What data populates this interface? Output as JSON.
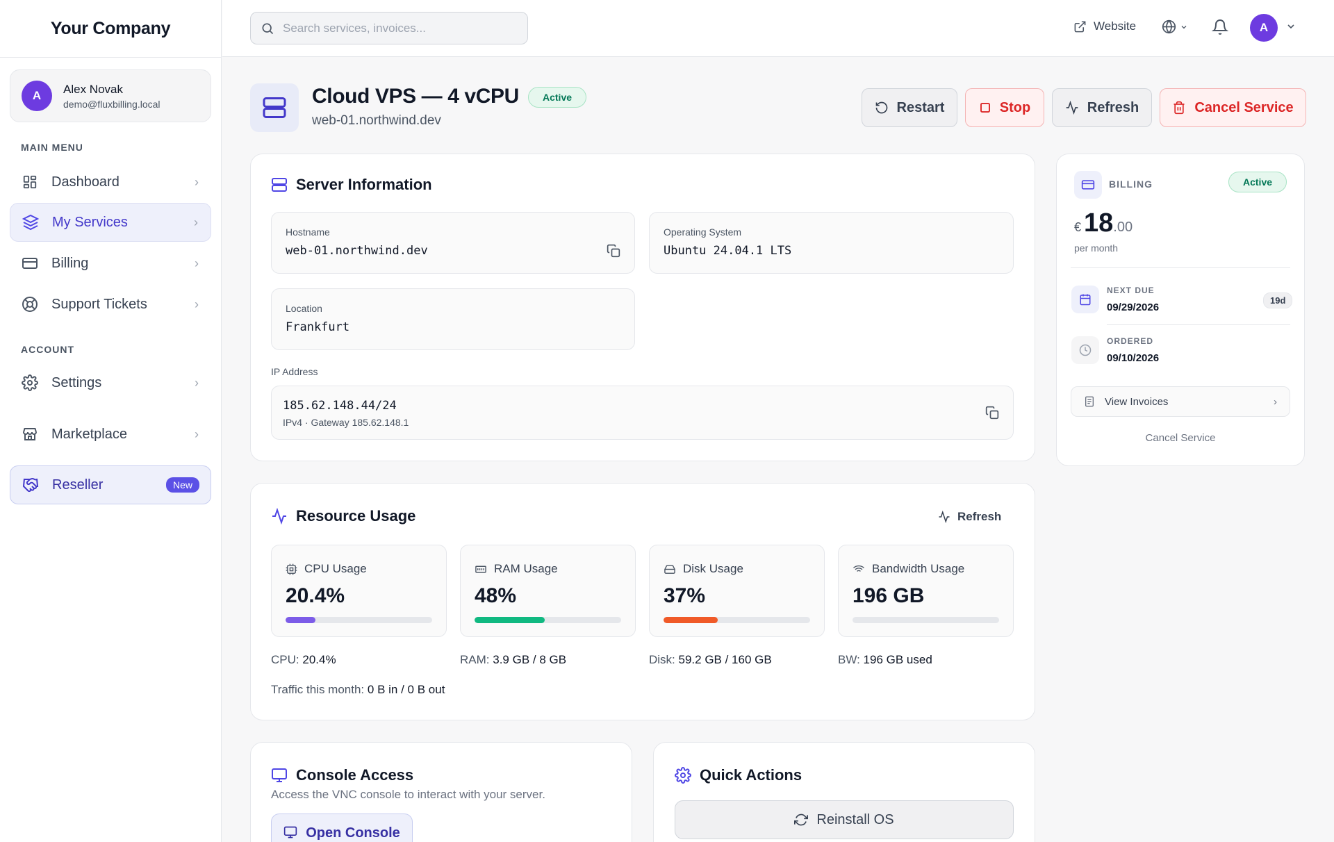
{
  "brand": "Your Company",
  "user": {
    "initial": "A",
    "name": "Alex Novak",
    "email": "demo@fluxbilling.local"
  },
  "sidebar": {
    "main_label": "MAIN MENU",
    "account_label": "ACCOUNT",
    "items": [
      {
        "label": "Dashboard",
        "icon": "dashboard-icon"
      },
      {
        "label": "My Services",
        "icon": "layers-icon"
      },
      {
        "label": "Billing",
        "icon": "credit-card-icon"
      },
      {
        "label": "Support Tickets",
        "icon": "lifebuoy-icon"
      },
      {
        "label": "Settings",
        "icon": "gear-icon"
      },
      {
        "label": "Marketplace",
        "icon": "store-icon"
      },
      {
        "label": "Reseller",
        "icon": "handshake-icon",
        "badge": "New"
      }
    ]
  },
  "header": {
    "search_placeholder": "Search services, invoices...",
    "website_label": "Website",
    "avatar_initial": "A"
  },
  "service": {
    "title": "Cloud VPS — 4 vCPU",
    "status": "Active",
    "hostname": "web-01.northwind.dev",
    "actions": {
      "restart": "Restart",
      "stop": "Stop",
      "refresh": "Refresh",
      "cancel": "Cancel Service"
    }
  },
  "server_info": {
    "title": "Server Information",
    "hostname_label": "Hostname",
    "hostname_value": "web-01.northwind.dev",
    "os_label": "Operating System",
    "os_value": "Ubuntu 24.04.1 LTS",
    "location_label": "Location",
    "location_value": "Frankfurt",
    "ip_label": "IP Address",
    "ip_value": "185.62.148.44/24",
    "ip_sub": "IPv4 · Gateway 185.62.148.1"
  },
  "resources": {
    "title": "Resource Usage",
    "refresh": "Refresh",
    "metrics": [
      {
        "label": "CPU Usage",
        "value": "20.4%",
        "percent": 20.4,
        "color": "#7c5ce8",
        "detail_label": "CPU:",
        "detail_value": "20.4%"
      },
      {
        "label": "RAM Usage",
        "value": "48%",
        "percent": 48,
        "color": "#10b981",
        "detail_label": "RAM:",
        "detail_value": "3.9 GB / 8 GB"
      },
      {
        "label": "Disk Usage",
        "value": "37%",
        "percent": 37,
        "color": "#f05a28",
        "detail_label": "Disk:",
        "detail_value": "59.2 GB / 160 GB"
      },
      {
        "label": "Bandwidth Usage",
        "value": "196 GB",
        "percent": 0,
        "color": "#9ca3af",
        "detail_label": "BW:",
        "detail_value": "196 GB used"
      }
    ],
    "traffic_label": "Traffic this month:",
    "traffic_value": "0 B in / 0 B out"
  },
  "billing": {
    "label": "BILLING",
    "status": "Active",
    "currency": "€",
    "amount_int": "18",
    "amount_dec": ".00",
    "period": "per month",
    "next_due_label": "NEXT DUE",
    "next_due_value": "09/29/2026",
    "days_left": "19d",
    "ordered_label": "ORDERED",
    "ordered_value": "09/10/2026",
    "view_invoices": "View Invoices",
    "cancel": "Cancel Service"
  },
  "console": {
    "title": "Console Access",
    "subtitle": "Access the VNC console to interact with your server.",
    "button": "Open Console"
  },
  "quick_actions": {
    "title": "Quick Actions",
    "reinstall": "Reinstall OS"
  },
  "colors": {
    "accent": "#4f46e5",
    "danger": "#dc2626",
    "success": "#047857"
  }
}
